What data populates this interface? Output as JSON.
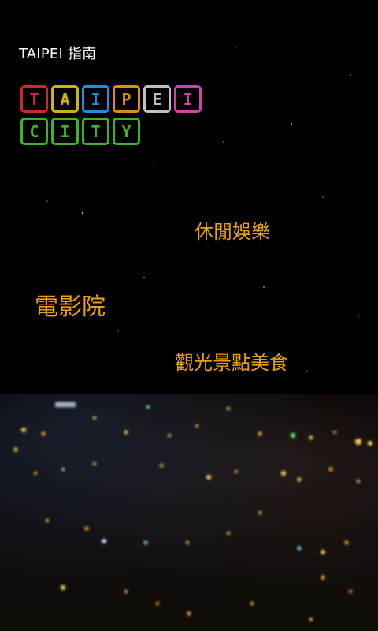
{
  "header": {
    "title": "TAIPEI 指南"
  },
  "logo": {
    "row1": [
      {
        "letter": "T",
        "color": "#d02828"
      },
      {
        "letter": "A",
        "color": "#c8b414"
      },
      {
        "letter": "I",
        "color": "#1e8ee0"
      },
      {
        "letter": "P",
        "color": "#e08c14"
      },
      {
        "letter": "E",
        "color": "#c0c0c0"
      },
      {
        "letter": "I",
        "color": "#d040b0"
      }
    ],
    "row2": [
      {
        "letter": "C",
        "color": "#3cb428"
      },
      {
        "letter": "I",
        "color": "#3cb428"
      },
      {
        "letter": "T",
        "color": "#3cb428"
      },
      {
        "letter": "Y",
        "color": "#3cb428"
      }
    ]
  },
  "menu": {
    "leisure": "休閒娛樂",
    "cinema": "電影院",
    "tour": "觀光景點美食",
    "color": "#e8a010"
  }
}
